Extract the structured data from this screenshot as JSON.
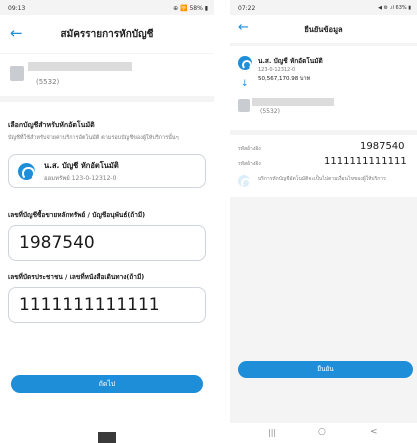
{
  "left": {
    "status": {
      "time": "09:13",
      "right": "⊕ 🛜 58% ▮"
    },
    "header": {
      "title": "สมัครรายการหักบัญชี"
    },
    "account_card": {
      "number": "(5532)"
    },
    "section": {
      "heading": "เลือกบัญชีสำหรับหักอัตโนมัติ",
      "description": "บัญชีที่ใช้สำหรับจ่ายค่าบริการอัตโนมัติ ตามรอบบัญชีของผู้ให้บริการนั้นๆ"
    },
    "kbank_card": {
      "name": "น.ส. บัญชี  หักอัตโนมัติ",
      "sub": "ออมทรัพย์ 123-0-12312-0"
    },
    "field1": {
      "label": "เลขที่บัญชีซื้อขายหลักทรัพย์ / บัญชีอนุพันธ์(ถ้ามี)",
      "value": "1987540"
    },
    "field2": {
      "label": "เลขที่บัตรประชาชน / เลขที่หนังสือเดินทาง(ถ้ามี)",
      "value": "1111111111111"
    },
    "next_button": "ถัดไป"
  },
  "right": {
    "status": {
      "time": "07:22",
      "right": "◀ ⚙ .ıl 63% ▮"
    },
    "header": {
      "title": "ยืนยันข้อมูล"
    },
    "from": {
      "name": "น.ส. บัญชี  หักอัตโนมัติ",
      "account": "123-0-12312-0",
      "balance": "50,567,170.98 บาท"
    },
    "to": {
      "number": "(5532)"
    },
    "ref1": {
      "label": "รหัสอ้างอิง",
      "value": "1987540"
    },
    "ref2": {
      "label": "รหัสอ้างอิง",
      "value": "1111111111111"
    },
    "notice": "บริการหักบัญชีอัตโนมัติจะเป็นไปตามเงื่อนไขของผู้ให้บริการ",
    "confirm_button": "ยืนยัน",
    "nav": {
      "recent": "|||",
      "home": "○",
      "back": "<"
    }
  },
  "colors": {
    "accent": "#1e8ed8"
  }
}
